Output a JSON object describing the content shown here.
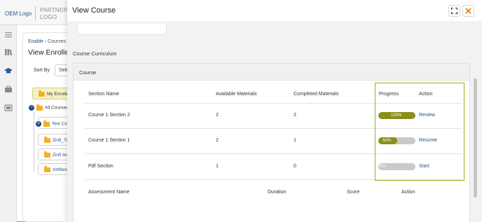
{
  "app": {
    "oem_logo": "OEM Logo",
    "partner_logo_line1": "PARTNER",
    "partner_logo_line2": "LOGO"
  },
  "background": {
    "breadcrumb_root": "Enable",
    "breadcrumb_current": "Courses",
    "page_title": "View Enrolled",
    "sort_label": "Sort By",
    "sort_value": "Select",
    "tree": {
      "root": "My Enrolled",
      "all_courses": "All Courses",
      "nodes": [
        "Test Course",
        "Zinfi_Training",
        "Zinfi test",
        "zinfitest"
      ]
    }
  },
  "modal": {
    "title": "View Course",
    "section_heading": "Course Curriculum",
    "card_title": "Course",
    "columns": [
      "Section Name",
      "Available Materials",
      "Completed Materials",
      "Progress",
      "Action"
    ],
    "rows": [
      {
        "section": "Course 1 Section 2",
        "available": "2",
        "completed": "2",
        "progress_text": "100%",
        "progress_value": 1.0,
        "action": "Review"
      },
      {
        "section": "Course 1 Section 1",
        "available": "2",
        "completed": "1",
        "progress_text": "50%",
        "progress_value": 0.5,
        "action": "Resume"
      },
      {
        "section": "Pdf Section",
        "available": "1",
        "completed": "0",
        "progress_text": "0%",
        "progress_value": 0.0,
        "action": "Start"
      }
    ],
    "assessment_columns": [
      "Assessment Name",
      "Duration",
      "Score",
      "Action"
    ]
  },
  "colors": {
    "accent": "#1f4f8f",
    "progress_fill": "#8c8e1c",
    "highlight": "#a4ad1c",
    "close": "#e8760a"
  },
  "icons": [
    "library-icon",
    "graduation-cap-icon",
    "briefcase-icon",
    "media-folder-icon",
    "expand-icon",
    "close-icon",
    "folder-icon"
  ]
}
